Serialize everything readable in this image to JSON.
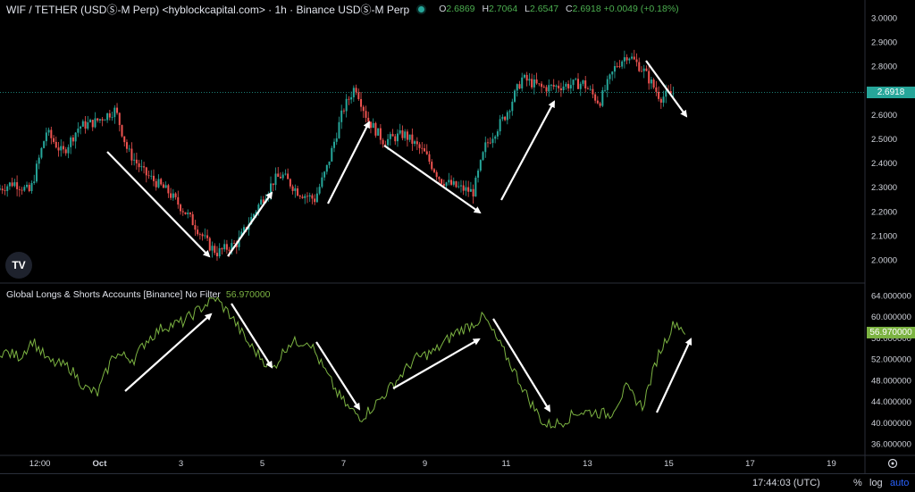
{
  "header": {
    "symbol": "WIF / TETHER (USDⓈ-M Perp) <hyblockcapital.com> · 1h · Binance USDⓈ-M Perp",
    "o_label": "O",
    "o_value": "2.6869",
    "h_label": "H",
    "h_value": "2.7064",
    "l_label": "L",
    "l_value": "2.6547",
    "c_label": "C",
    "c_value": "2.6918 +0.0049 (+0.18%)"
  },
  "indicator": {
    "title": "Global Longs & Shorts Accounts [Binance] No Filter",
    "value": "56.970000"
  },
  "price_axis": {
    "ticks": [
      "3.0000",
      "2.9000",
      "2.8000",
      "2.7000",
      "2.6000",
      "2.5000",
      "2.4000",
      "2.3000",
      "2.2000",
      "2.1000",
      "2.0000"
    ],
    "last_price": "2.6918"
  },
  "indicator_axis": {
    "ticks": [
      "64.000000",
      "60.000000",
      "56.000000",
      "52.000000",
      "48.000000",
      "44.000000",
      "40.000000",
      "36.000000"
    ],
    "last_value": "56.970000"
  },
  "time_axis": {
    "labels": [
      "12:00",
      "Oct",
      "3",
      "5",
      "7",
      "9",
      "11",
      "13",
      "15",
      "17",
      "19"
    ]
  },
  "bottom_bar": {
    "time": "17:44:03 (UTC)",
    "percent": "%",
    "log": "log",
    "auto": "auto"
  },
  "logo_text": "TV",
  "colors": {
    "up": "#26a69a",
    "down": "#ef5350",
    "indicator": "#7cb342",
    "accent": "#2962ff"
  },
  "chart_data": [
    {
      "type": "candlestick",
      "title": "WIF / TETHER (USDⓈ-M Perp) 1h",
      "ylim": [
        1.95,
        3.05
      ],
      "x_labels": [
        "12:00",
        "Oct",
        "3",
        "5",
        "7",
        "9",
        "11",
        "13",
        "15",
        "17",
        "19"
      ],
      "anchors_x_days": [
        0,
        1.36,
        3.36,
        5.36,
        7.36,
        9.36,
        11.36,
        13.36,
        15.36
      ],
      "price_path": [
        [
          0.0,
          2.29
        ],
        [
          0.4,
          2.32
        ],
        [
          0.8,
          2.28
        ],
        [
          1.2,
          2.53
        ],
        [
          1.6,
          2.44
        ],
        [
          2.0,
          2.55
        ],
        [
          2.4,
          2.57
        ],
        [
          2.9,
          2.62
        ],
        [
          3.2,
          2.45
        ],
        [
          3.6,
          2.36
        ],
        [
          4.2,
          2.28
        ],
        [
          4.7,
          2.18
        ],
        [
          5.2,
          2.06
        ],
        [
          5.4,
          2.03
        ],
        [
          5.9,
          2.07
        ],
        [
          6.4,
          2.22
        ],
        [
          6.8,
          2.33
        ],
        [
          7.0,
          2.35
        ],
        [
          7.4,
          2.28
        ],
        [
          7.8,
          2.25
        ],
        [
          8.1,
          2.38
        ],
        [
          8.5,
          2.62
        ],
        [
          8.8,
          2.72
        ],
        [
          9.1,
          2.58
        ],
        [
          9.5,
          2.49
        ],
        [
          10.0,
          2.52
        ],
        [
          10.5,
          2.44
        ],
        [
          10.9,
          2.33
        ],
        [
          11.3,
          2.3
        ],
        [
          11.7,
          2.28
        ],
        [
          12.0,
          2.47
        ],
        [
          12.5,
          2.6
        ],
        [
          12.9,
          2.75
        ],
        [
          13.4,
          2.71
        ],
        [
          13.9,
          2.72
        ],
        [
          14.4,
          2.73
        ],
        [
          14.8,
          2.65
        ],
        [
          15.2,
          2.8
        ],
        [
          15.5,
          2.85
        ],
        [
          15.9,
          2.78
        ],
        [
          16.3,
          2.67
        ],
        [
          16.6,
          2.69
        ]
      ],
      "last": {
        "o": 2.6869,
        "h": 2.7064,
        "l": 2.6547,
        "c": 2.6918
      }
    },
    {
      "type": "line",
      "title": "Global Longs & Shorts Accounts [Binance] No Filter",
      "ylim": [
        35,
        65
      ],
      "series": [
        {
          "name": "Global Longs & Shorts Accounts [Binance] No Filter",
          "points": [
            [
              0.0,
              53.5
            ],
            [
              0.5,
              52.5
            ],
            [
              0.8,
              55.5
            ],
            [
              1.2,
              51.5
            ],
            [
              1.7,
              50.5
            ],
            [
              2.1,
              46.5
            ],
            [
              2.4,
              45.5
            ],
            [
              2.8,
              53.0
            ],
            [
              3.3,
              52.0
            ],
            [
              3.6,
              55.5
            ],
            [
              4.0,
              58.0
            ],
            [
              4.5,
              59.0
            ],
            [
              5.0,
              62.0
            ],
            [
              5.3,
              63.5
            ],
            [
              5.7,
              60.0
            ],
            [
              6.1,
              55.0
            ],
            [
              6.4,
              52.5
            ],
            [
              6.7,
              50.0
            ],
            [
              7.1,
              55.0
            ],
            [
              7.6,
              55.5
            ],
            [
              7.9,
              51.0
            ],
            [
              8.3,
              45.5
            ],
            [
              8.6,
              42.5
            ],
            [
              8.9,
              41.0
            ],
            [
              9.3,
              44.0
            ],
            [
              9.7,
              47.5
            ],
            [
              10.2,
              52.0
            ],
            [
              10.7,
              53.5
            ],
            [
              11.2,
              57.0
            ],
            [
              11.6,
              58.5
            ],
            [
              11.9,
              60.0
            ],
            [
              12.2,
              56.0
            ],
            [
              12.6,
              50.5
            ],
            [
              13.0,
              44.5
            ],
            [
              13.4,
              39.5
            ],
            [
              13.8,
              40.0
            ],
            [
              14.2,
              42.0
            ],
            [
              14.6,
              42.0
            ],
            [
              15.0,
              41.5
            ],
            [
              15.4,
              46.5
            ],
            [
              15.8,
              43.0
            ],
            [
              16.2,
              53.0
            ],
            [
              16.6,
              59.0
            ],
            [
              16.9,
              57.0
            ]
          ]
        }
      ]
    }
  ]
}
